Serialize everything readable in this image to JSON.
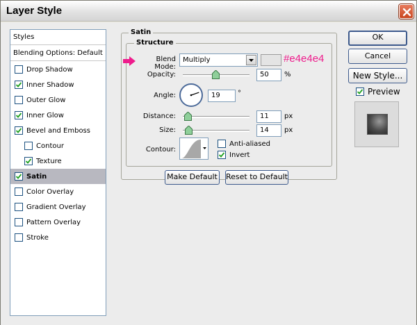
{
  "window": {
    "title": "Layer Style"
  },
  "styles_list": [
    {
      "label": "Styles",
      "has_checkbox": false,
      "checked": false,
      "header": true,
      "indent": false,
      "selected": false
    },
    {
      "label": "Blending Options: Default",
      "has_checkbox": false,
      "checked": false,
      "header": true,
      "indent": false,
      "selected": false
    },
    {
      "label": "Drop Shadow",
      "has_checkbox": true,
      "checked": false,
      "header": false,
      "indent": false,
      "selected": false
    },
    {
      "label": "Inner Shadow",
      "has_checkbox": true,
      "checked": true,
      "header": false,
      "indent": false,
      "selected": false
    },
    {
      "label": "Outer Glow",
      "has_checkbox": true,
      "checked": false,
      "header": false,
      "indent": false,
      "selected": false
    },
    {
      "label": "Inner Glow",
      "has_checkbox": true,
      "checked": true,
      "header": false,
      "indent": false,
      "selected": false
    },
    {
      "label": "Bevel and Emboss",
      "has_checkbox": true,
      "checked": true,
      "header": false,
      "indent": false,
      "selected": false
    },
    {
      "label": "Contour",
      "has_checkbox": true,
      "checked": false,
      "header": false,
      "indent": true,
      "selected": false
    },
    {
      "label": "Texture",
      "has_checkbox": true,
      "checked": true,
      "header": false,
      "indent": true,
      "selected": false
    },
    {
      "label": "Satin",
      "has_checkbox": true,
      "checked": true,
      "header": false,
      "indent": false,
      "selected": true
    },
    {
      "label": "Color Overlay",
      "has_checkbox": true,
      "checked": false,
      "header": false,
      "indent": false,
      "selected": false
    },
    {
      "label": "Gradient Overlay",
      "has_checkbox": true,
      "checked": false,
      "header": false,
      "indent": false,
      "selected": false
    },
    {
      "label": "Pattern Overlay",
      "has_checkbox": true,
      "checked": false,
      "header": false,
      "indent": false,
      "selected": false
    },
    {
      "label": "Stroke",
      "has_checkbox": true,
      "checked": false,
      "header": false,
      "indent": false,
      "selected": false
    }
  ],
  "satin": {
    "group_title": "Satin",
    "structure_title": "Structure",
    "blend_mode_label": "Blend Mode:",
    "blend_mode_value": "Multiply",
    "color_swatch": "#e4e4e4",
    "color_annotation": "#e4e4e4",
    "opacity_label": "Opacity:",
    "opacity_value": "50",
    "opacity_unit": "%",
    "angle_label": "Angle:",
    "angle_value": "19",
    "angle_unit": "°",
    "distance_label": "Distance:",
    "distance_value": "11",
    "distance_unit": "px",
    "size_label": "Size:",
    "size_value": "14",
    "size_unit": "px",
    "contour_label": "Contour:",
    "anti_aliased_label": "Anti-aliased",
    "anti_aliased_checked": false,
    "invert_label": "Invert",
    "invert_checked": true,
    "make_default_label": "Make Default",
    "reset_default_label": "Reset to Default"
  },
  "actions": {
    "ok_label": "OK",
    "cancel_label": "Cancel",
    "new_style_label": "New Style...",
    "preview_label": "Preview",
    "preview_checked": true
  },
  "colors": {
    "annotation": "#ee1c8c",
    "selected_row": "#b8b8c0",
    "close_button": "#c9461f"
  }
}
